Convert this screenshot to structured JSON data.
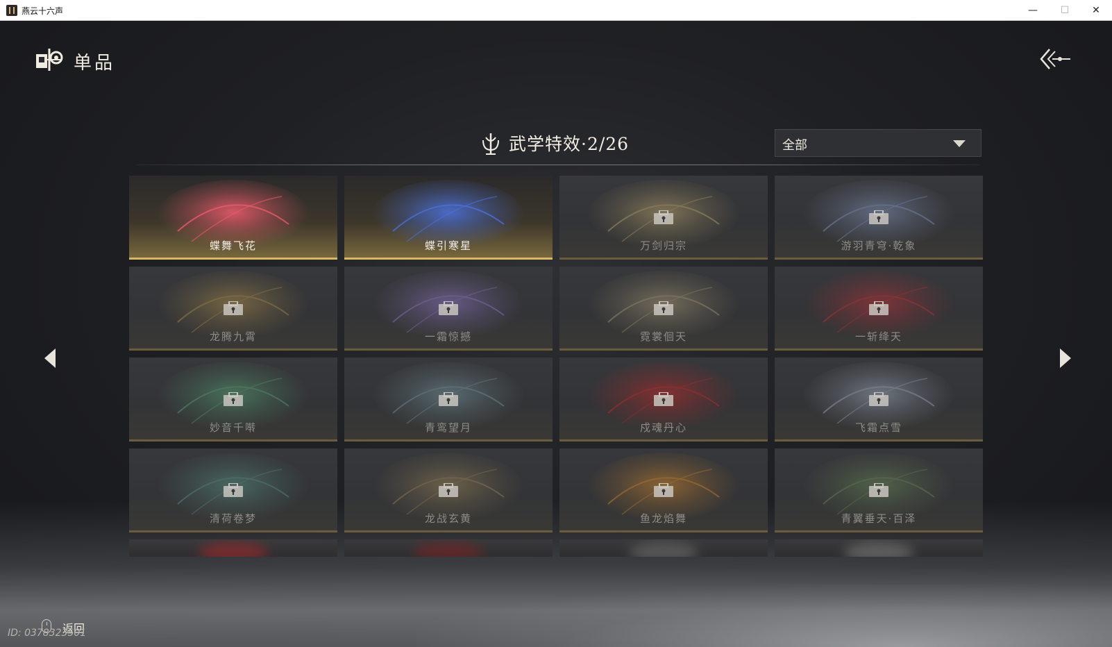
{
  "window": {
    "title": "燕云十六声",
    "controls": {
      "minimize": "—",
      "maximize": "☐",
      "close": "✕"
    }
  },
  "header": {
    "title": "单品",
    "icon": "item-icon",
    "back_icon": "back-arrow-icon"
  },
  "section": {
    "icon": "martial-arts-icon",
    "title": "武学特效·2/26"
  },
  "filter": {
    "value": "全部"
  },
  "colors": {
    "accent_gold": "#d8b865",
    "locked_bar": "#6a5d3d",
    "background": "#1c1d1f"
  },
  "cards": [
    {
      "label": "蝶舞飞花",
      "locked": false,
      "theme": "#e85a6a"
    },
    {
      "label": "蝶引寒星",
      "locked": false,
      "theme": "#4b6fd6"
    },
    {
      "label": "万剑归宗",
      "locked": true,
      "theme": "#c9b173"
    },
    {
      "label": "游羽青穹·乾象",
      "locked": true,
      "theme": "#8da1c9"
    },
    {
      "label": "龙腾九霄",
      "locked": true,
      "theme": "#b8964f"
    },
    {
      "label": "一霜惊撼",
      "locked": true,
      "theme": "#9a7fd1"
    },
    {
      "label": "霓裳佪天",
      "locked": true,
      "theme": "#b4a37d"
    },
    {
      "label": "一斩绛天",
      "locked": true,
      "theme": "#c6343a"
    },
    {
      "label": "妙音千啭",
      "locked": true,
      "theme": "#5fae7d"
    },
    {
      "label": "青鸾望月",
      "locked": true,
      "theme": "#7fa0a8"
    },
    {
      "label": "戍魂丹心",
      "locked": true,
      "theme": "#d12a2a"
    },
    {
      "label": "飞霜点雪",
      "locked": true,
      "theme": "#a9b6c8"
    },
    {
      "label": "清荷卷梦",
      "locked": true,
      "theme": "#5f9a8c"
    },
    {
      "label": "龙战玄黄",
      "locked": true,
      "theme": "#a28b5c"
    },
    {
      "label": "鱼龙焰舞",
      "locked": true,
      "theme": "#e0902e"
    },
    {
      "label": "青翼垂天·百泽",
      "locked": true,
      "theme": "#6f8f5a"
    }
  ],
  "partial_cards": [
    {
      "theme": "#a02a2a"
    },
    {
      "theme": "#7a2424"
    },
    {
      "theme": "#6d6d6d"
    },
    {
      "theme": "#7a7a7a"
    }
  ],
  "footer": {
    "back_label": "返回",
    "mouse_icon": "mouse-icon",
    "player_id": "ID: 0378323501"
  }
}
